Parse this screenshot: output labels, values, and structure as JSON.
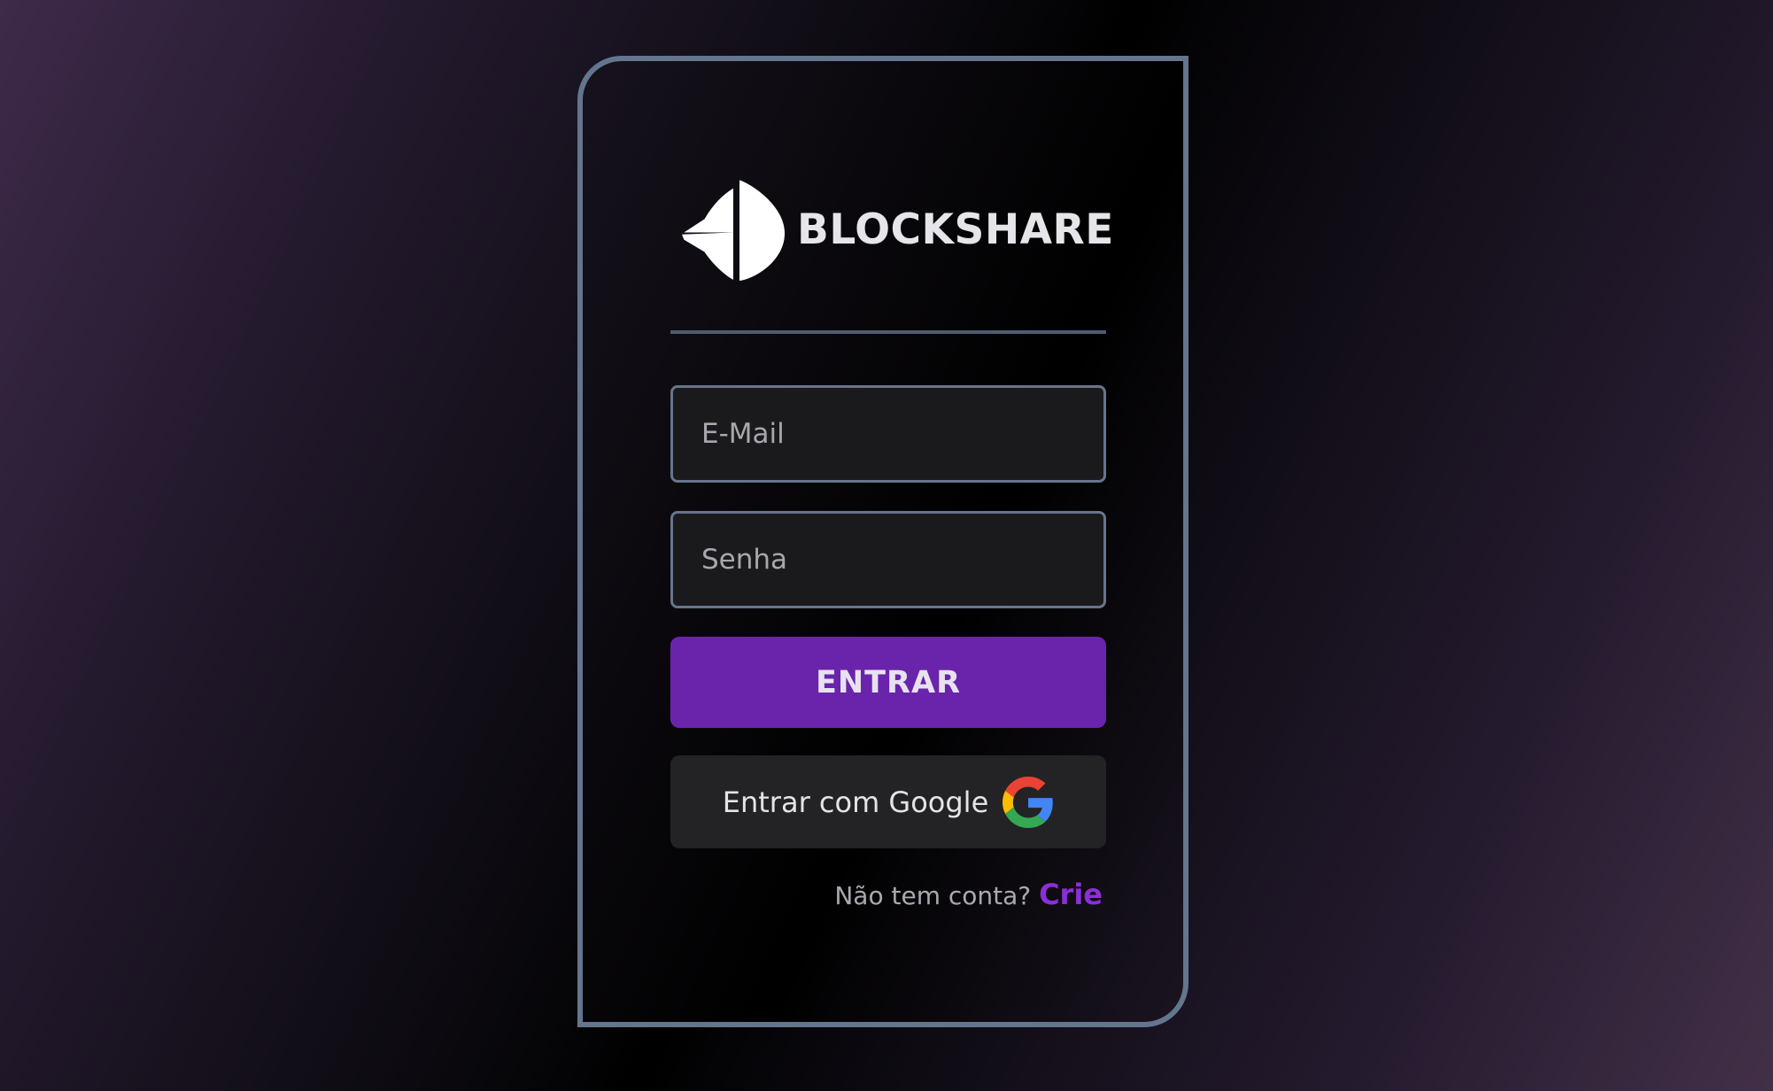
{
  "brand": {
    "name": "BLOCKSHARE",
    "logo_icon": "sail-logo-icon"
  },
  "form": {
    "email_placeholder": "E-Mail",
    "email_value": "",
    "password_placeholder": "Senha",
    "password_value": "",
    "submit_label": "ENTRAR",
    "google_label": "Entrar com Google",
    "google_icon": "google-icon"
  },
  "signup": {
    "prompt": "Não tem conta?",
    "link_label": "Crie"
  },
  "colors": {
    "accent": "#6a24ac",
    "link": "#8b2fd8",
    "card_border": "#64758e"
  }
}
